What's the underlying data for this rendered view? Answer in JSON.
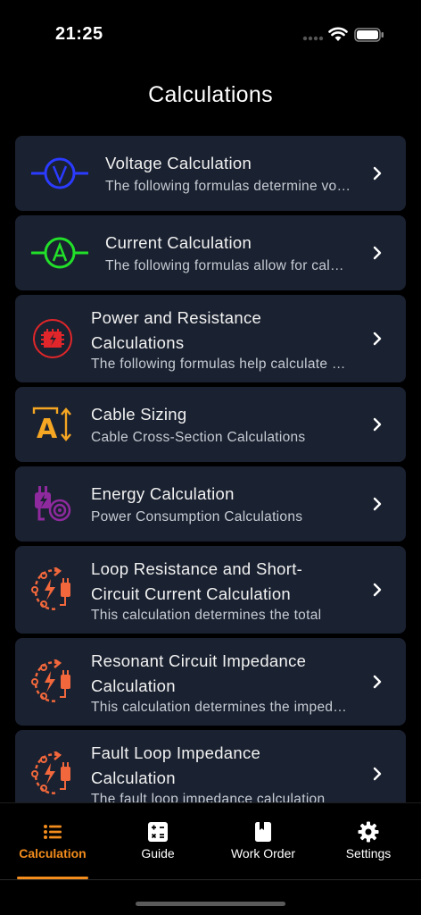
{
  "status_bar": {
    "time": "21:25"
  },
  "header": {
    "title": "Calculations"
  },
  "items": [
    {
      "title": "Voltage Calculation",
      "subtitle": "The following formulas determine voltage",
      "icon": "voltmeter-icon",
      "color": "#2b3bff"
    },
    {
      "title": "Current Calculation",
      "subtitle": "The following formulas allow for calculating current",
      "icon": "ammeter-icon",
      "color": "#22e02a"
    },
    {
      "title": "Power and Resistance Calculations",
      "subtitle": "The following formulas help calculate power",
      "icon": "resistor-power-icon",
      "color": "#e0262a"
    },
    {
      "title": "Cable Sizing",
      "subtitle": "Cable Cross-Section Calculations",
      "icon": "cable-size-icon",
      "color": "#f5a623"
    },
    {
      "title": "Energy Calculation",
      "subtitle": "Power Consumption Calculations",
      "icon": "energy-plug-icon",
      "color": "#8e2a9e"
    },
    {
      "title": "Loop Resistance and Short-Circuit Current Calculation",
      "subtitle": "This calculation determines the total",
      "icon": "loop-circuit-icon",
      "color": "#f2683c"
    },
    {
      "title": "Resonant Circuit Impedance Calculation",
      "subtitle": "This calculation determines the impedance",
      "icon": "loop-circuit-icon",
      "color": "#f2683c"
    },
    {
      "title": "Fault Loop Impedance Calculation",
      "subtitle": "The fault loop impedance calculation",
      "icon": "loop-circuit-icon",
      "color": "#f2683c"
    }
  ],
  "tabs": [
    {
      "label": "Calculation",
      "icon": "list-icon",
      "active": true
    },
    {
      "label": "Guide",
      "icon": "calculator-icon",
      "active": false
    },
    {
      "label": "Work Order",
      "icon": "bookmark-book-icon",
      "active": false
    },
    {
      "label": "Settings",
      "icon": "gear-icon",
      "active": false
    }
  ],
  "colors": {
    "accent": "#f28c1c",
    "card_bg": "#1a2130",
    "background": "#000000"
  }
}
